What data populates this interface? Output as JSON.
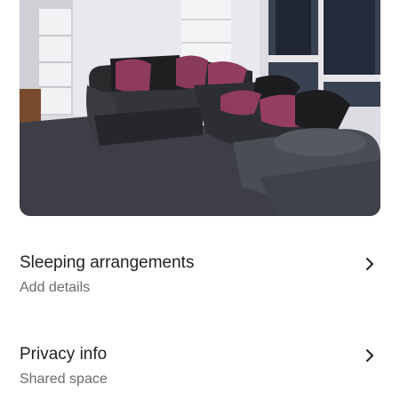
{
  "listing": {
    "photo_icon": "living-room-photo"
  },
  "sections": [
    {
      "title": "Sleeping arrangements",
      "subtitle": "Add details",
      "icon": "chevron-right-icon"
    },
    {
      "title": "Privacy info",
      "subtitle": "Shared space",
      "icon": "chevron-right-icon"
    }
  ],
  "colors": {
    "text_primary": "#222222",
    "text_secondary": "#6a6a6a",
    "background": "#ffffff"
  }
}
